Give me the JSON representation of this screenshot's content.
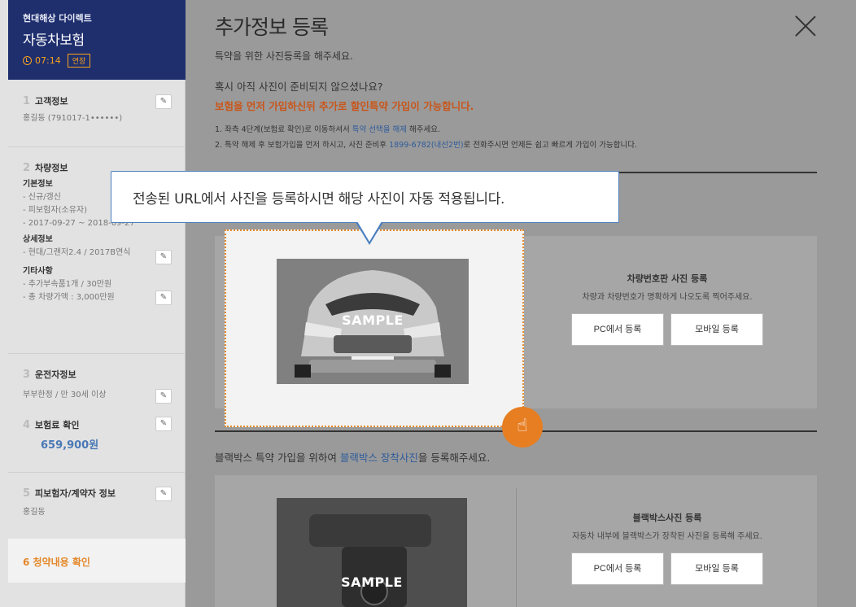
{
  "sidebar": {
    "brand": "현대해상 다이렉트",
    "title": "자동차보험",
    "timer": "07:14",
    "extend_label": "연장",
    "sections": [
      {
        "num": "1",
        "title": "고객정보",
        "lines": [
          "홍길동 (791017-1••••••)"
        ]
      },
      {
        "num": "2",
        "title": "차량정보"
      },
      {
        "num": "3",
        "title": "운전자정보",
        "lines": [
          "부부한정 / 만 30세 이상"
        ]
      },
      {
        "num": "4",
        "title": "보험료 확인",
        "price": "659,900원"
      },
      {
        "num": "5",
        "title": "피보험자/계약자 정보",
        "lines": [
          "홍길동"
        ]
      },
      {
        "num": "6",
        "title": "청약내용 확인"
      }
    ],
    "vehicle": {
      "basic_title": "기본정보",
      "basic_lines": [
        "- 신규/갱신",
        "- 피보험자(소유자)",
        "- 2017-09-27 ~ 2018-09-27"
      ],
      "detail_title": "상세정보",
      "detail_lines": [
        "- 현대/그랜저2.4 / 2017B연식"
      ],
      "etc_title": "기타사항",
      "etc_lines": [
        "- 추가부속품1개 / 30만원",
        "- 총 차량가액 : 3,000만원"
      ]
    }
  },
  "main": {
    "title": "추가정보 등록",
    "subtitle": "특약을 위한 사진등록을 해주세요.",
    "question": "혹시 아직 사진이 준비되지 않으셨나요?",
    "question_hint": "보험을 먼저 가입하신뒤 추가로 할인특약 가입이 가능합니다.",
    "note1_a": "1. 좌측 4단계(보험료 확인)로 이동하셔서 ",
    "note1_link": "특약 선택을 해제",
    "note1_b": " 해주세요.",
    "note2_a": "2. 특약 해제 후 보험가입을 먼저 하시고, 사진 준비후 ",
    "note2_link": "1899-6782(내선2번)",
    "note2_b": "로 전화주시면 언제든 쉽고 빠르게 가입이 가능합니다.",
    "tooltip": "전송된 URL에서 사진을 등록하시면 해당 사진이 자동 적용됩니다.",
    "sample_label": "SAMPLE",
    "plate": {
      "title": "차량번호판 사진 등록",
      "desc": "차량과 차량번호가 명확하게 나오도록 찍어주세요.",
      "pc_btn": "PC에서 등록",
      "mobile_btn": "모바일 등록"
    },
    "blackbox_prompt_a": "블랙박스 특약 가입을 위하여 ",
    "blackbox_prompt_link": "블랙박스 장착사진",
    "blackbox_prompt_b": "을 등록해주세요.",
    "blackbox": {
      "title": "블랙박스사진 등록",
      "desc": "자동차 내부에 블랙박스가 장착된 사진을 등록해 주세요.",
      "pc_btn": "PC에서 등록",
      "mobile_btn": "모바일 등록"
    }
  },
  "colors": {
    "accent": "#e77e22",
    "brand": "#1f2f6e",
    "link": "#2f5c9a"
  }
}
